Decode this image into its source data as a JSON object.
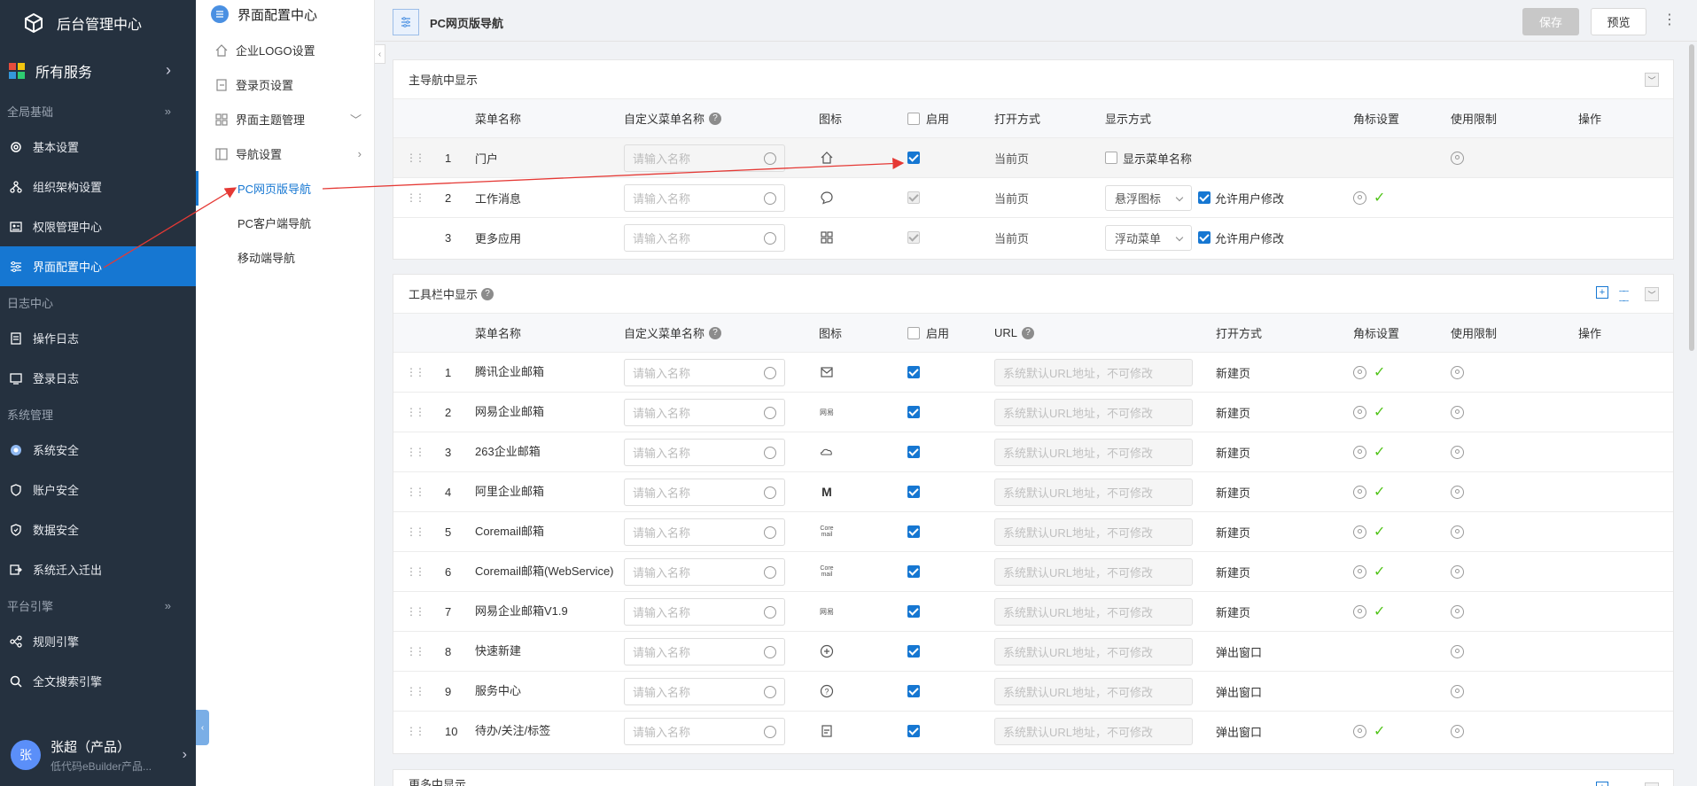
{
  "app": {
    "title": "后台管理中心",
    "all_services": "所有服务"
  },
  "sidebar": {
    "groups": [
      {
        "label": "全局基础"
      },
      {
        "label": "日志中心"
      },
      {
        "label": "系统管理"
      },
      {
        "label": "平台引擎"
      }
    ],
    "items": [
      {
        "label": "基本设置"
      },
      {
        "label": "组织架构设置"
      },
      {
        "label": "权限管理中心"
      },
      {
        "label": "界面配置中心"
      },
      {
        "label": "操作日志"
      },
      {
        "label": "登录日志"
      },
      {
        "label": "系统安全"
      },
      {
        "label": "账户安全"
      },
      {
        "label": "数据安全"
      },
      {
        "label": "系统迁入迁出"
      },
      {
        "label": "规则引擎"
      },
      {
        "label": "全文搜索引擎"
      }
    ],
    "user": {
      "avatar": "张",
      "name": "张超（产品）",
      "subtitle": "低代码eBuilder产品..."
    }
  },
  "subnav": {
    "title": "界面配置中心",
    "items": [
      {
        "label": "企业LOGO设置"
      },
      {
        "label": "登录页设置"
      },
      {
        "label": "界面主题管理"
      },
      {
        "label": "导航设置"
      },
      {
        "label": "PC网页版导航"
      },
      {
        "label": "PC客户端导航"
      },
      {
        "label": "移动端导航"
      }
    ]
  },
  "header": {
    "title": "PC网页版导航",
    "save": "保存",
    "preview": "预览"
  },
  "main_nav": {
    "title": "主导航中显示",
    "columns": {
      "name": "菜单名称",
      "custom": "自定义菜单名称",
      "icon": "图标",
      "enable": "启用",
      "open": "打开方式",
      "display": "显示方式",
      "badge": "角标设置",
      "limit": "使用限制",
      "ops": "操作"
    },
    "placeholder": "请输入名称",
    "rows": [
      {
        "idx": "1",
        "name": "门户",
        "open": "当前页",
        "display_cb": "显示菜单名称"
      },
      {
        "idx": "2",
        "name": "工作消息",
        "open": "当前页",
        "display": "悬浮图标",
        "allow": "允许用户修改"
      },
      {
        "idx": "3",
        "name": "更多应用",
        "open": "当前页",
        "display": "浮动菜单",
        "allow": "允许用户修改"
      }
    ]
  },
  "toolbar_nav": {
    "title": "工具栏中显示",
    "columns": {
      "name": "菜单名称",
      "custom": "自定义菜单名称",
      "icon": "图标",
      "enable": "启用",
      "url": "URL",
      "open": "打开方式",
      "badge": "角标设置",
      "limit": "使用限制",
      "ops": "操作"
    },
    "placeholder": "请输入名称",
    "url_placeholder": "系统默认URL地址，不可修改",
    "rows": [
      {
        "idx": "1",
        "name": "腾讯企业邮箱",
        "open": "新建页"
      },
      {
        "idx": "2",
        "name": "网易企业邮箱",
        "open": "新建页"
      },
      {
        "idx": "3",
        "name": "263企业邮箱",
        "open": "新建页"
      },
      {
        "idx": "4",
        "name": "阿里企业邮箱",
        "open": "新建页"
      },
      {
        "idx": "5",
        "name": "Coremail邮箱",
        "open": "新建页"
      },
      {
        "idx": "6",
        "name": "Coremail邮箱(WebService)",
        "open": "新建页"
      },
      {
        "idx": "7",
        "name": "网易企业邮箱V1.9",
        "open": "新建页"
      },
      {
        "idx": "8",
        "name": "快速新建",
        "open": "弹出窗口"
      },
      {
        "idx": "9",
        "name": "服务中心",
        "open": "弹出窗口"
      },
      {
        "idx": "10",
        "name": "待办/关注/标签",
        "open": "弹出窗口"
      }
    ]
  },
  "more_section": {
    "title": "更多中显示"
  },
  "colors": {
    "accent": "#1677d2",
    "sidebar_bg": "#25313f",
    "annotation": "#e53935"
  }
}
